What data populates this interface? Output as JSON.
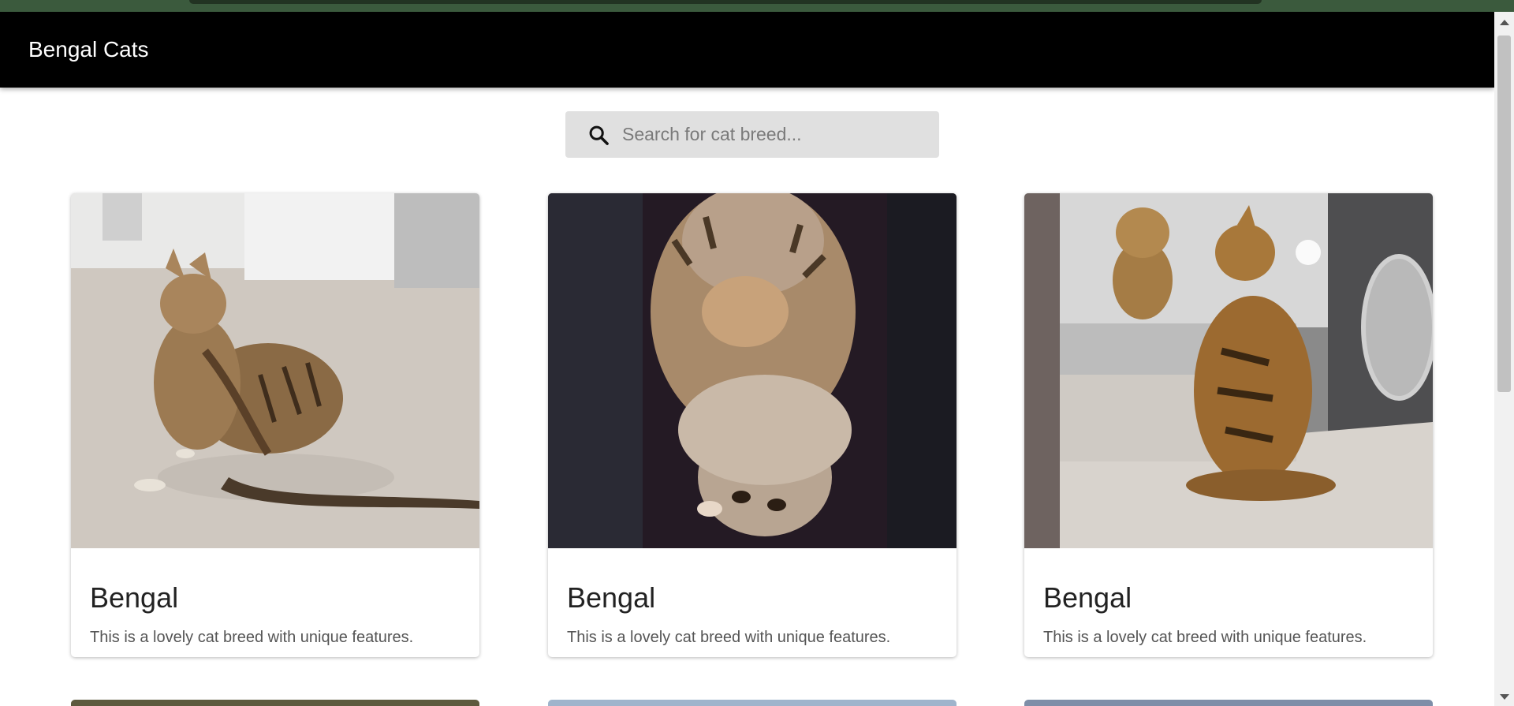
{
  "app": {
    "title": "Bengal Cats"
  },
  "search": {
    "placeholder": "Search for cat breed...",
    "value": "",
    "icon": "search-icon"
  },
  "cards": [
    {
      "name": "Bengal",
      "description": "This is a lovely cat breed with unique features.",
      "image": "cat-scratching-photo"
    },
    {
      "name": "Bengal",
      "description": "This is a lovely cat breed with unique features.",
      "image": "cat-upside-down-photo"
    },
    {
      "name": "Bengal",
      "description": "This is a lovely cat breed with unique features.",
      "image": "cat-mirror-photo"
    }
  ],
  "colors": {
    "appbar": "#000000",
    "search_bg": "#e0e0e0",
    "page_bg": "#ffffff"
  }
}
